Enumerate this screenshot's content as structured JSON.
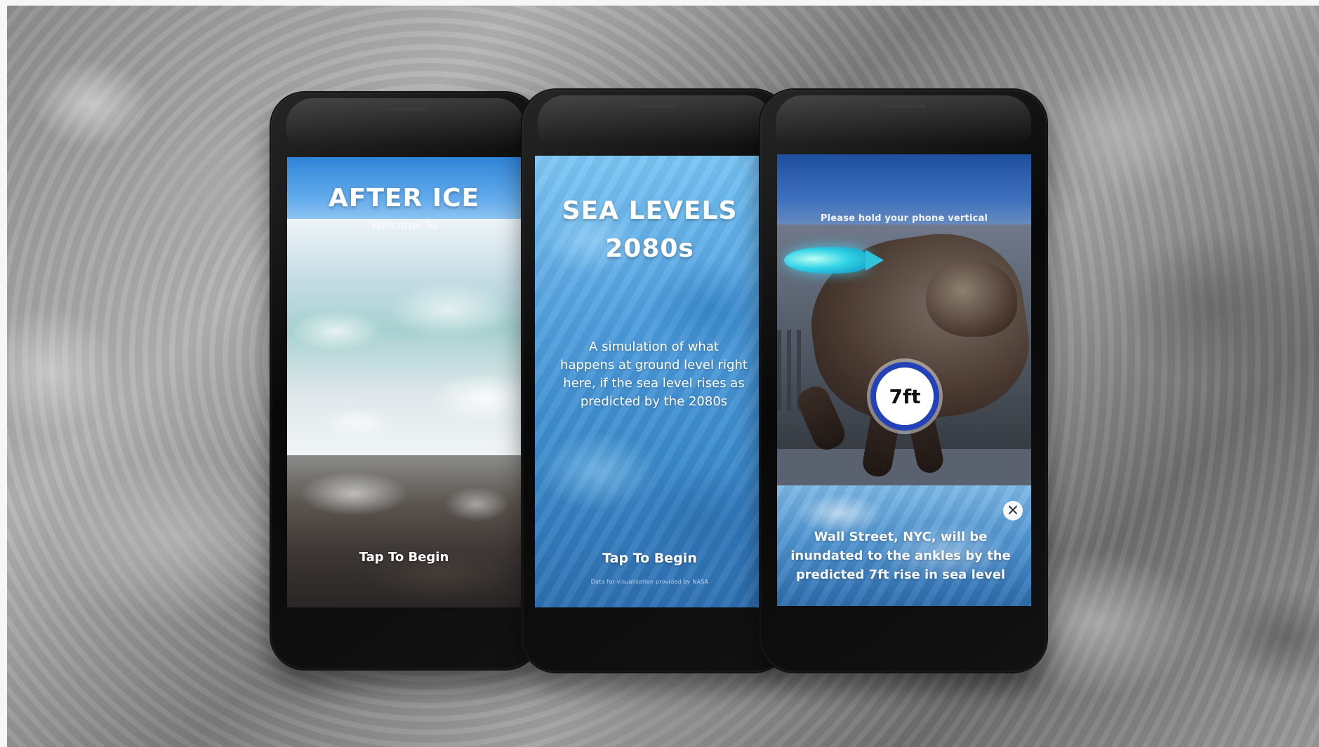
{
  "screens": {
    "left": {
      "app_title": "AFTER ICE",
      "welcome_text": "Welcome To",
      "cta_label": "Tap To Begin"
    },
    "middle": {
      "title": "SEA LEVELS\n2080s",
      "description": "A simulation of what happens at ground level right here, if the sea level rises as predicted by the 2080s",
      "cta_label": "Tap To Begin",
      "fine_print": "Data for visualisation provided by NASA"
    },
    "right": {
      "instruction": "Please hold your phone vertical",
      "depth_label": "7ft",
      "info_text": "Wall Street, NYC, will be inundated to the ankles by the predicted 7ft rise in sea level",
      "close_label": "×"
    }
  },
  "icons": {
    "close": "close-icon",
    "depth": "water-depth-icon"
  },
  "colors": {
    "phone_body": "#0a0a0a",
    "ice_blue": "#4d9cdd",
    "badge_ring": "#2442b8",
    "text_white": "#ffffff"
  }
}
